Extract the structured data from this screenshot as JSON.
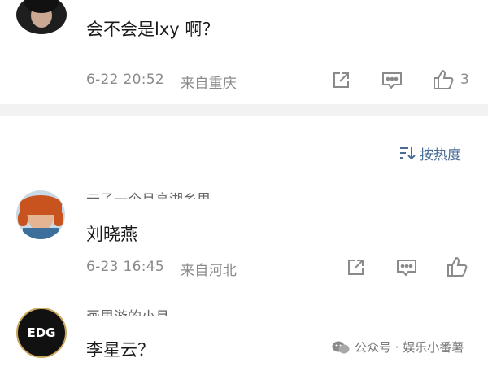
{
  "comments": [
    {
      "text": "会不会是lxy 啊？",
      "time": "6-22 20:52",
      "location": "来自重庆",
      "like_count": "3"
    },
    {
      "username": "云子一个月亮湖乡里",
      "text": "刘晓燕",
      "time": "6-23 16:45",
      "location": "来自河北"
    },
    {
      "username": "画里游的小月",
      "avatar_text": "EDG",
      "text": "李星云？"
    }
  ],
  "sort": {
    "label": "按热度"
  },
  "watermark": {
    "text": "公众号 · 娱乐小番薯"
  },
  "icons": [
    "share-icon",
    "comment-icon",
    "like-icon",
    "sort-icon",
    "wechat-icon"
  ],
  "colors": {
    "sort_accent": "#4a6d97",
    "meta_gray": "#8a8a8a",
    "band_gray": "#f2f2f2"
  }
}
